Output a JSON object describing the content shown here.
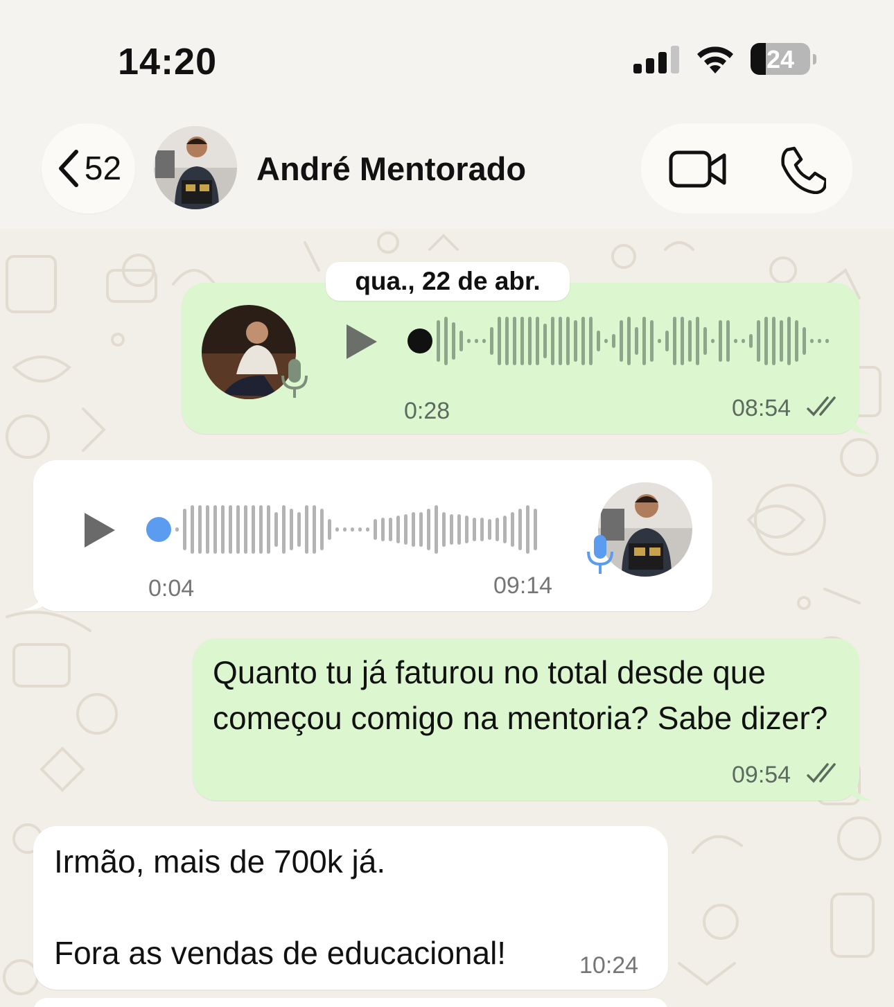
{
  "status_bar": {
    "time": "14:20",
    "battery": "24"
  },
  "header": {
    "back_count": "52",
    "contact_name": "André Mentorado",
    "icons": {
      "back": "chevron-left-icon",
      "video": "video-camera-icon",
      "call": "phone-icon"
    }
  },
  "chat": {
    "date_label": "qua., 22 de abr.",
    "messages": [
      {
        "direction": "outgoing",
        "type": "voice",
        "duration": "0:28",
        "time": "08:54",
        "status": "read"
      },
      {
        "direction": "incoming",
        "type": "voice",
        "duration": "0:04",
        "time": "09:14"
      },
      {
        "direction": "outgoing",
        "type": "text",
        "text": "Quanto tu já faturou no total desde que começou comigo na mentoria? Sabe dizer?",
        "time": "09:54",
        "status": "read"
      },
      {
        "direction": "incoming",
        "type": "text",
        "text": "Irmão, mais de 700k já.\n\nFora as vendas de educacional!",
        "time": "10:24"
      }
    ]
  },
  "colors": {
    "outgoing_bubble": "#dcf7d0",
    "incoming_bubble": "#ffffff",
    "waveform_outgoing": "#8fa58a",
    "waveform_incoming": "#b3b3b3",
    "mic_incoming": "#5b9cf0",
    "mic_outgoing": "#7d8f7a",
    "progress_dot_incoming": "#5b9cf0"
  }
}
